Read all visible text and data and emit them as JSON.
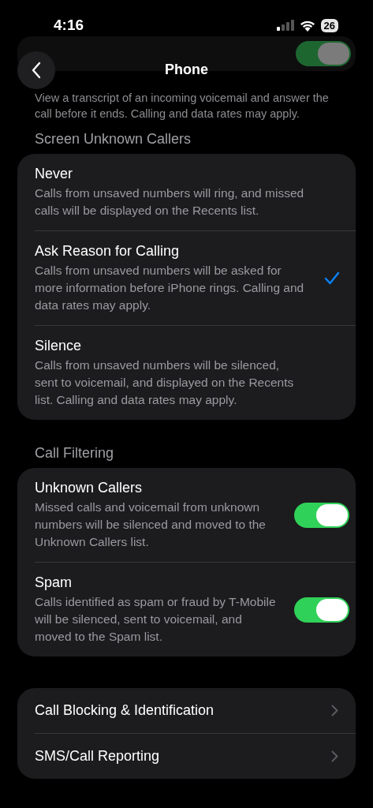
{
  "status_bar": {
    "time": "4:16",
    "battery": "26"
  },
  "nav": {
    "title": "Phone"
  },
  "live_voicemail": {
    "on": true,
    "footer": "View a transcript of an incoming voicemail and answer the call before it ends. Calling and data rates may apply."
  },
  "screen_unknown_callers": {
    "header": "Screen Unknown Callers",
    "options": [
      {
        "title": "Never",
        "description": "Calls from unsaved numbers will ring, and missed calls will be displayed on the Recents list.",
        "selected": false
      },
      {
        "title": "Ask Reason for Calling",
        "description": "Calls from unsaved numbers will be asked for more information before iPhone rings. Calling and data rates may apply.",
        "selected": true
      },
      {
        "title": "Silence",
        "description": "Calls from unsaved numbers will be silenced, sent to voicemail, and displayed on the Recents list. Calling and data rates may apply.",
        "selected": false
      }
    ]
  },
  "call_filtering": {
    "header": "Call Filtering",
    "items": [
      {
        "title": "Unknown Callers",
        "description": "Missed calls and voicemail from unknown numbers will be silenced and moved to the Unknown Callers list.",
        "on": true
      },
      {
        "title": "Spam",
        "description": "Calls identified as spam or fraud by T-Mobile will be silenced, sent to voicemail, and moved to the Spam list.",
        "on": true
      }
    ]
  },
  "links": [
    {
      "label": "Call Blocking & Identification"
    },
    {
      "label": "SMS/Call Reporting"
    }
  ]
}
